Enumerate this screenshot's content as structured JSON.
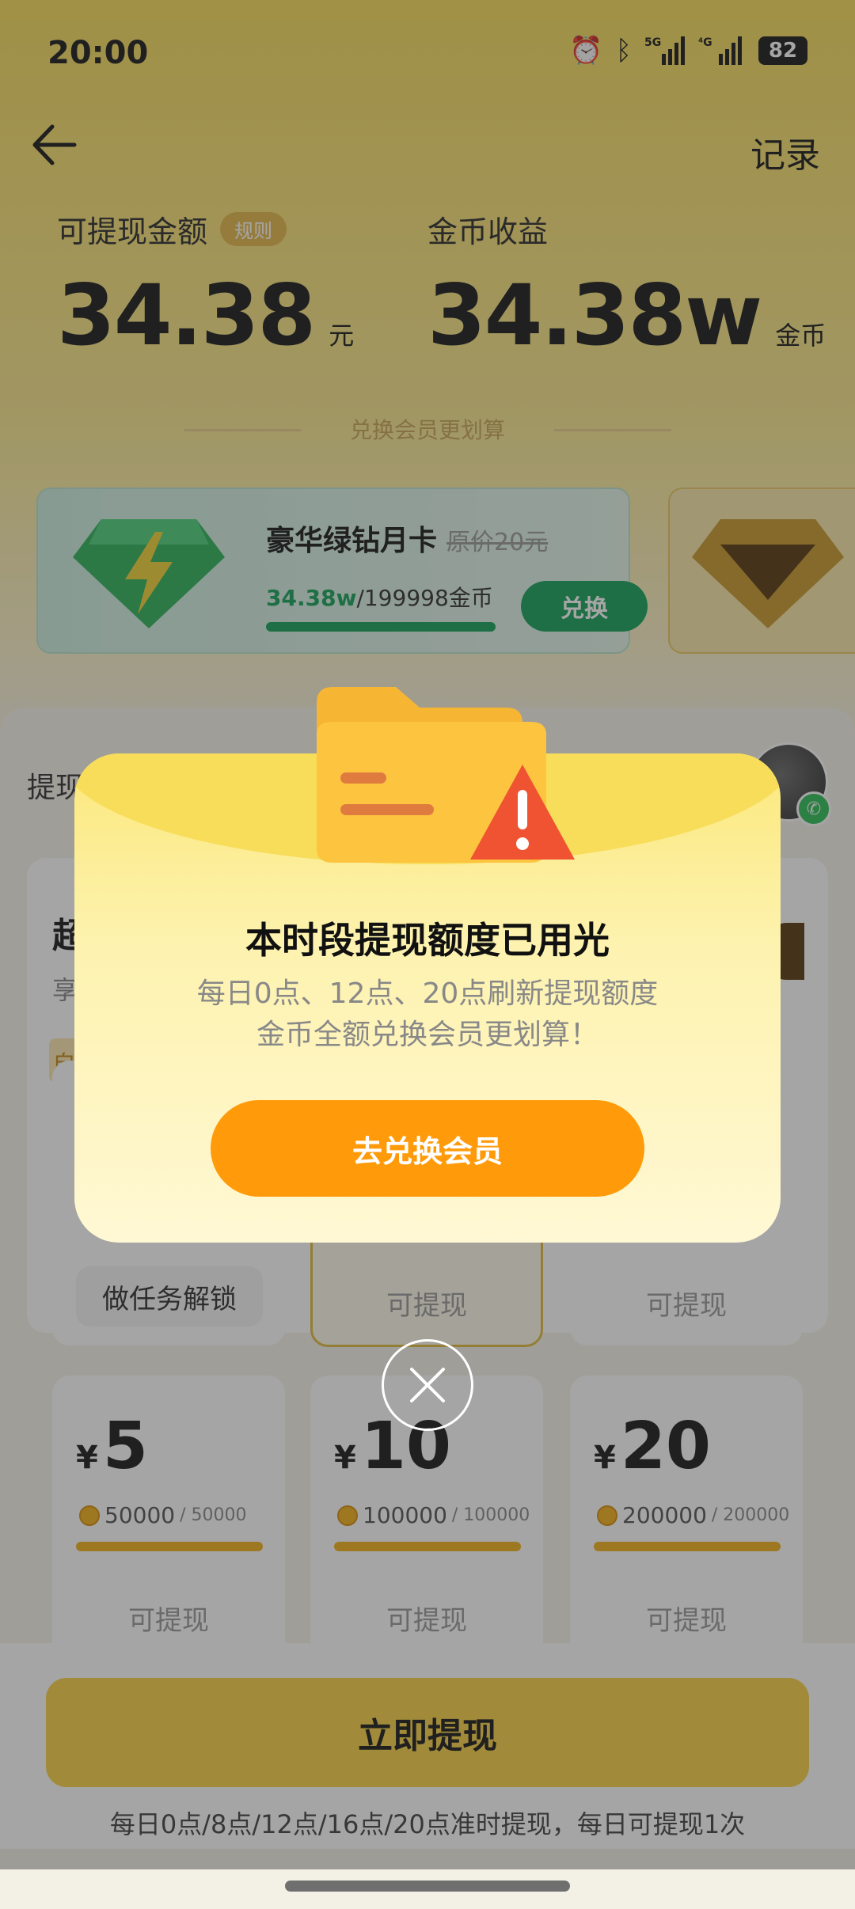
{
  "status_bar": {
    "time": "20:00",
    "battery": "82",
    "icons": [
      "alarm-icon",
      "bluetooth-icon",
      "5g-signal-icon",
      "4g-signal-icon",
      "battery-icon"
    ]
  },
  "header": {
    "record_label": "记录"
  },
  "withdrawable": {
    "label": "可提现金额",
    "rule_badge": "规则",
    "amount": "34.38",
    "unit": "元"
  },
  "coin_income": {
    "label": "金币收益",
    "amount": "34.38w",
    "unit": "金币"
  },
  "divider_text": "兑换会员更划算",
  "vip_card": {
    "title": "豪华绿钻月卡",
    "original_price": "原价20元",
    "progress_current": "34.38w",
    "progress_total": "/199998金币",
    "exchange_label": "兑换"
  },
  "lower": {
    "withdraw_label": "提现",
    "super_title": "超",
    "super_sub": "享",
    "tag": "自",
    "task_button": "做任务解锁",
    "status_withdrawable": "可提现",
    "tiles": [
      {
        "yen": "¥",
        "price": "5",
        "coins": "50000",
        "cap": "/ 50000",
        "status": "可提现"
      },
      {
        "yen": "¥",
        "price": "10",
        "coins": "100000",
        "cap": "/ 100000",
        "status": "可提现"
      },
      {
        "yen": "¥",
        "price": "20",
        "coins": "200000",
        "cap": "/ 200000",
        "status": "可提现"
      }
    ]
  },
  "bottom": {
    "cta": "立即提现",
    "note": "每日0点/8点/12点/16点/20点准时提现，每日可提现1次"
  },
  "modal": {
    "title": "本时段提现额度已用光",
    "desc_line1": "每日0点、12点、20点刷新提现额度",
    "desc_line2": "金币全额兑换会员更划算！",
    "button": "去兑换会员"
  },
  "colors": {
    "accent_orange": "#ff9b0a",
    "green": "#18a35a",
    "yellow": "#f8d348"
  }
}
